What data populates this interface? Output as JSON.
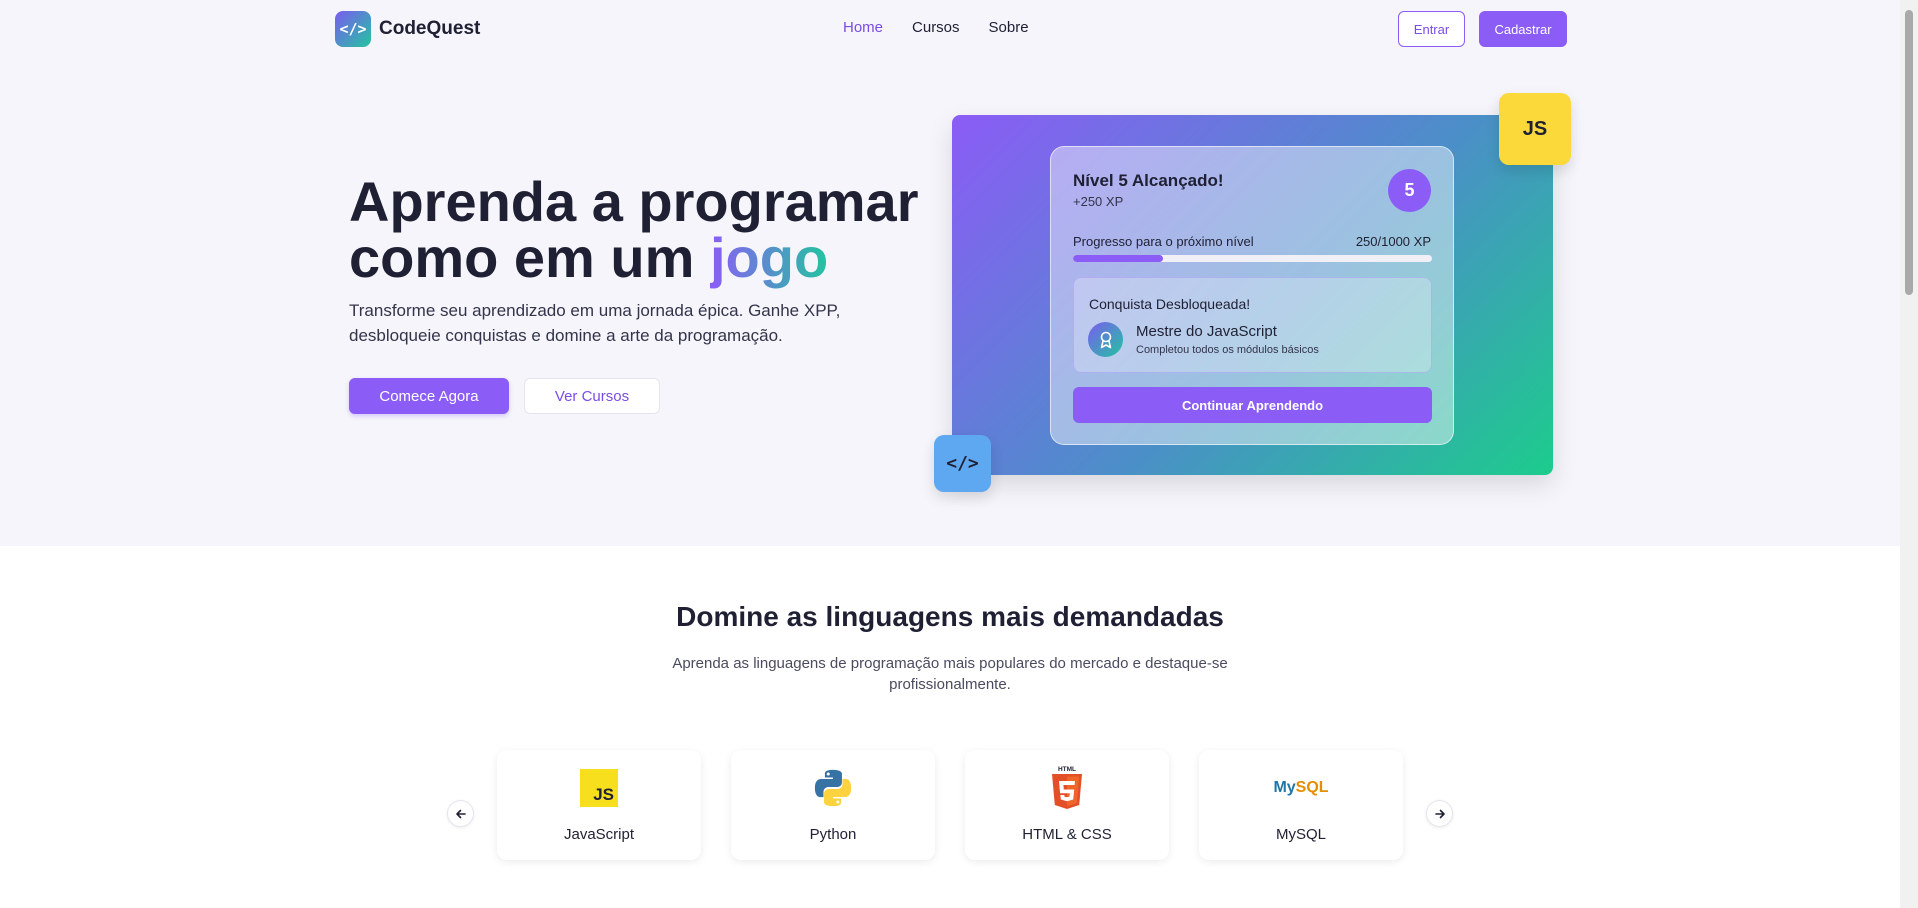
{
  "brand": {
    "name": "CodeQuest",
    "logo_glyph": "</>"
  },
  "nav": {
    "items": [
      {
        "label": "Home",
        "active": true
      },
      {
        "label": "Cursos",
        "active": false
      },
      {
        "label": "Sobre",
        "active": false
      }
    ]
  },
  "auth": {
    "login_label": "Entrar",
    "signup_label": "Cadastrar"
  },
  "hero": {
    "title_line1": "Aprenda a programar",
    "title_line2_prefix": "como em um ",
    "title_accent": "jogo",
    "subtitle": "Transforme seu aprendizado em uma jornada épica. Ganhe XPP, desbloqueie conquistas e domine a arte da programação.",
    "primary_button": "Comece Agora",
    "secondary_button": "Ver Cursos"
  },
  "level_card": {
    "title": "Nível 5 Alcançado!",
    "xp_gain": "+250 XP",
    "level_number": "5",
    "progress_label": "Progresso para o próximo nível",
    "progress_value": "250/1000 XP",
    "progress_fraction": 0.25,
    "achievement_heading": "Conquista Desbloqueada!",
    "achievement_name": "Mestre do JavaScript",
    "achievement_desc": "Completou todos os módulos básicos",
    "continue_button": "Continuar Aprendendo"
  },
  "floating_badges": {
    "js": "JS",
    "code": "</>"
  },
  "languages_section": {
    "title": "Domine as linguagens mais demandadas",
    "subtitle": "Aprenda as linguagens de programação mais populares do mercado e destaque-se profissionalmente.",
    "prev_icon": "arrow-left-icon",
    "next_icon": "arrow-right-icon",
    "languages": [
      {
        "name": "JavaScript",
        "icon": "javascript-icon",
        "icon_text": "JS"
      },
      {
        "name": "Python",
        "icon": "python-icon"
      },
      {
        "name": "HTML & CSS",
        "icon": "html5-icon",
        "icon_text": "HTML"
      },
      {
        "name": "MySQL",
        "icon": "mysql-icon",
        "icon_text_a": "My",
        "icon_text_b": "SQL"
      }
    ]
  },
  "colors": {
    "primary": "#8b5cf6",
    "teal": "#22c4a0",
    "js_yellow": "#fcd93b",
    "code_blue": "#5ea8f2"
  }
}
